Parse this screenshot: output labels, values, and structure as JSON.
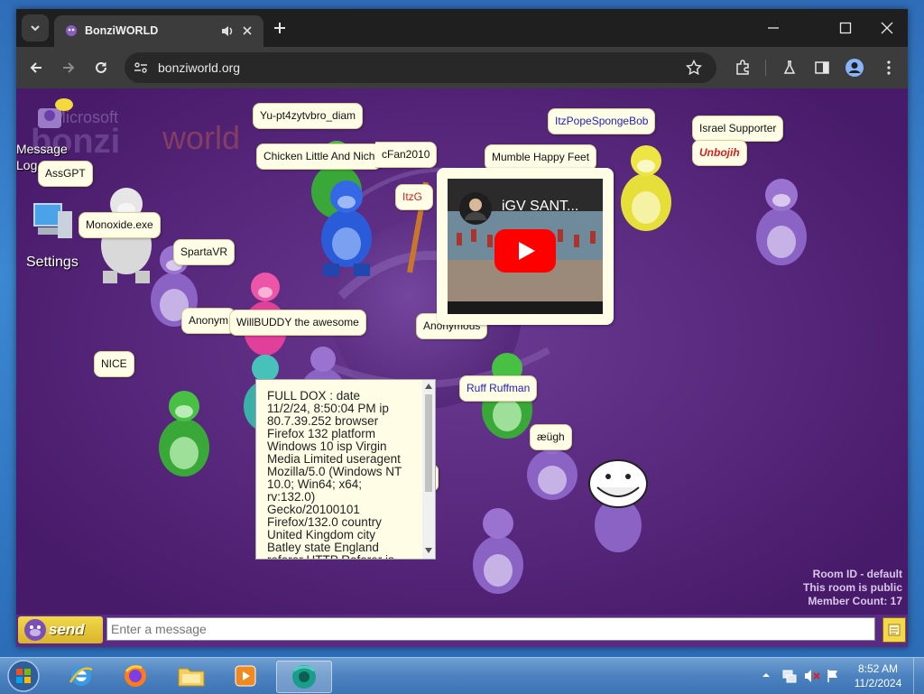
{
  "browser": {
    "tab_title": "BonziWORLD",
    "address": "bonziworld.org"
  },
  "desktop_left": {
    "message_log": "Message Log",
    "settings": "Settings",
    "logo_small": "Microsoft",
    "logo_world": "world",
    "logo_bonzi": "bonzi"
  },
  "bubbles": {
    "yu": "Yu-pt4zytvbro_diam",
    "chicken": "Chicken Little And Nich",
    "cfan": "cFan2010",
    "mumble": "Mumble Happy Feet",
    "itzpope": "ItzPopeSpongeBob",
    "israel": "Israel Supporter",
    "unbojih": "Unbojih",
    "assgpt": "AssGPT",
    "monoxide": "Monoxide.exe",
    "sparta": "SpartaVR",
    "anony1": "Anonym",
    "willbuddy": "WillBUDDY the awesome",
    "anony2": "Anonymous",
    "nice": "NICE",
    "ruff": "Ruff Ruffman",
    "augh": "æügh",
    "itzg": "ItzG"
  },
  "youtube": {
    "title": "iGV SANT..."
  },
  "dox_text": "FULL DOX : date\n11/2/24, 8:50:04 PM ip\n80.7.39.252 browser\nFirefox 132 platform\nWindows 10 isp Virgin\nMedia Limited useragent\nMozilla/5.0 (Windows NT\n10.0; Win64; x64;\nrv:132.0)\nGecko/20100101\nFirefox/132.0 country\nUnited Kingdom city\nBatley state England\nreferer HTTP Referer is",
  "room": {
    "id": "Room ID - default",
    "public": "This room is public",
    "members": "Member Count: 17"
  },
  "chat": {
    "send_label": "send",
    "placeholder": "Enter a message"
  },
  "taskbar": {
    "time": "8:52 AM",
    "date": "11/2/2024"
  }
}
